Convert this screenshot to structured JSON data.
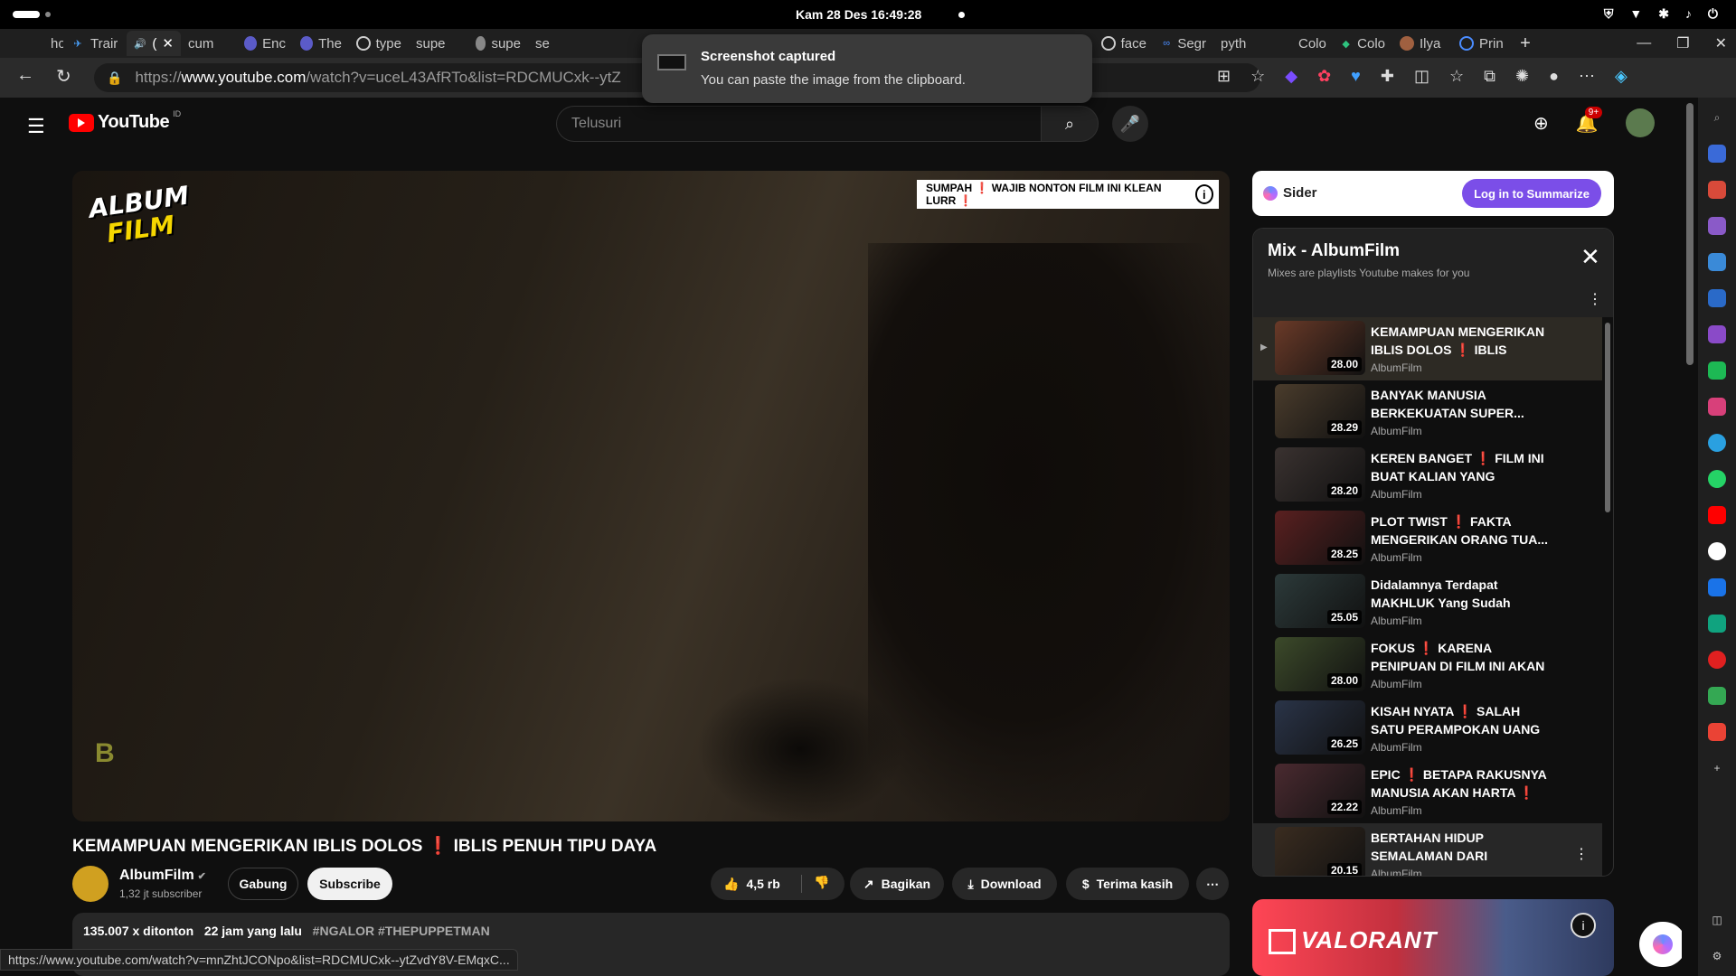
{
  "system": {
    "clock": "Kam 28 Des  16:49:28"
  },
  "browser": {
    "tabs": [
      "how",
      "Trair",
      "(",
      "cum",
      "Enc",
      "The",
      "type",
      "supe",
      "supe",
      "se",
      "face",
      "face",
      "Segr",
      "pyth",
      "Colo",
      "Colo",
      "Ilya",
      "Prin"
    ],
    "url_scheme": "https://",
    "url_host": "www.youtube.com",
    "url_path": "/watch?v=uceL43AfRTo&list=RDCMUCxk--ytZ",
    "status_url": "https://www.youtube.com/watch?v=mnZhtJCONpo&list=RDCMUCxk--ytZvdY8V-EMqxC..."
  },
  "toast": {
    "title": "Screenshot captured",
    "message": "You can paste the image from the clipboard."
  },
  "youtube": {
    "logo": "YouTube",
    "country_code": "ID",
    "search_placeholder": "Telusuri",
    "notification_badge": "9+"
  },
  "video": {
    "logo_line1": "ALBUM",
    "logo_line2": "FILM",
    "watermark": "B",
    "banner": "SUMPAH ❗ WAJIB NONTON FILM INI KLEAN LURR ❗",
    "title_part1": "KEMAMPUAN MENGERIKAN IBLIS DOLOS",
    "title_mark": "❗",
    "title_part2": "IBLIS PENUH TIPU DAYA",
    "channel": "AlbumFilm",
    "subscribers": "1,32 jt subscriber",
    "join_label": "Gabung",
    "subscribe_label": "Subscribe",
    "likes": "4,5 rb",
    "share_label": "Bagikan",
    "download_label": "Download",
    "thanks_label": "Terima kasih",
    "views": "135.007 x ditonton",
    "age": "22 jam yang lalu",
    "hashtags": "#NGALOR #THEPUPPETMAN"
  },
  "sider": {
    "name": "Sider",
    "button": "Log in to Summarize"
  },
  "mix": {
    "title": "Mix - AlbumFilm",
    "subtitle": "Mixes are playlists Youtube makes for you",
    "items": [
      {
        "title": "KEMAMPUAN MENGERIKAN IBLIS DOLOS ❗ IBLIS PENUH...",
        "channel": "AlbumFilm",
        "duration": "28.00",
        "color": "#6a3a28"
      },
      {
        "title": "BANYAK MANUSIA BERKEKUATAN SUPER...",
        "channel": "AlbumFilm",
        "duration": "28.29",
        "color": "#4a3c2c"
      },
      {
        "title": "KEREN BANGET ❗ FILM INI BUAT KALIAN YANG MERAS...",
        "channel": "AlbumFilm",
        "duration": "28.20",
        "color": "#3a3230"
      },
      {
        "title": "PLOT TWIST ❗ FAKTA MENGERIKAN ORANG TUA...",
        "channel": "AlbumFilm",
        "duration": "28.25",
        "color": "#5a2020"
      },
      {
        "title": "Didalamnya Terdapat MAKHLUK Yang Sudah Hidup...",
        "channel": "AlbumFilm",
        "duration": "25.05",
        "color": "#2c3a3a"
      },
      {
        "title": "FOKUS ❗ KARENA PENIPUAN DI FILM INI AKAN MEMBUAT...",
        "channel": "AlbumFilm",
        "duration": "28.00",
        "color": "#3c4a2a"
      },
      {
        "title": "KISAH NYATA ❗ SALAH SATU PERAMPOKAN UANG TUNAI...",
        "channel": "AlbumFilm",
        "duration": "26.25",
        "color": "#2a3448"
      },
      {
        "title": "EPIC ❗ BETAPA RAKUSNYA MANUSIA AKAN HARTA ❗",
        "channel": "AlbumFilm",
        "duration": "22.22",
        "color": "#4a2a30"
      },
      {
        "title": "BERTAHAN HIDUP SEMALAMAN DARI HARIMA...",
        "channel": "AlbumFilm",
        "duration": "20.15",
        "color": "#3a2c20"
      }
    ]
  },
  "ad": {
    "brand": "VALORANT"
  }
}
